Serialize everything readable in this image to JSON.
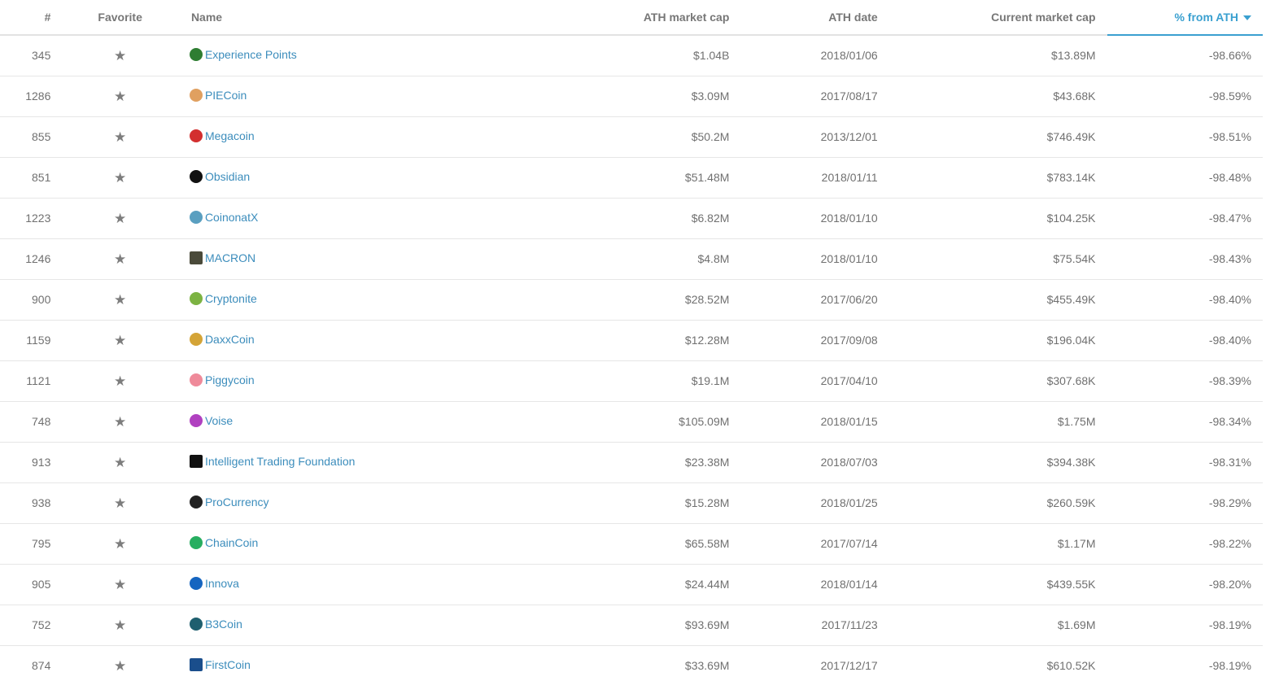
{
  "header": {
    "rank": "#",
    "favorite": "Favorite",
    "name": "Name",
    "ath_market_cap": "ATH market cap",
    "ath_date": "ATH date",
    "current_market_cap": "Current market cap",
    "pct_from_ath": "% from ATH"
  },
  "rows": [
    {
      "rank": "345",
      "name": "Experience Points",
      "icon": "experience-points-icon",
      "color": "#2e7d32",
      "ath_cap": "$1.04B",
      "ath_date": "2018/01/06",
      "cur_cap": "$13.89M",
      "pct": "-98.66%"
    },
    {
      "rank": "1286",
      "name": "PIECoin",
      "icon": "piecoin-icon",
      "color": "#e0a060",
      "ath_cap": "$3.09M",
      "ath_date": "2017/08/17",
      "cur_cap": "$43.68K",
      "pct": "-98.59%"
    },
    {
      "rank": "855",
      "name": "Megacoin",
      "icon": "megacoin-icon",
      "color": "#d32f2f",
      "ath_cap": "$50.2M",
      "ath_date": "2013/12/01",
      "cur_cap": "$746.49K",
      "pct": "-98.51%"
    },
    {
      "rank": "851",
      "name": "Obsidian",
      "icon": "obsidian-icon",
      "color": "#111111",
      "ath_cap": "$51.48M",
      "ath_date": "2018/01/11",
      "cur_cap": "$783.14K",
      "pct": "-98.48%"
    },
    {
      "rank": "1223",
      "name": "CoinonatX",
      "icon": "coinonatx-icon",
      "color": "#5a9fc0",
      "ath_cap": "$6.82M",
      "ath_date": "2018/01/10",
      "cur_cap": "$104.25K",
      "pct": "-98.47%"
    },
    {
      "rank": "1246",
      "name": "MACRON",
      "icon": "macron-icon",
      "color": "#4a4a3a",
      "ath_cap": "$4.8M",
      "ath_date": "2018/01/10",
      "cur_cap": "$75.54K",
      "pct": "-98.43%"
    },
    {
      "rank": "900",
      "name": "Cryptonite",
      "icon": "cryptonite-icon",
      "color": "#7cb342",
      "ath_cap": "$28.52M",
      "ath_date": "2017/06/20",
      "cur_cap": "$455.49K",
      "pct": "-98.40%"
    },
    {
      "rank": "1159",
      "name": "DaxxCoin",
      "icon": "daxxcoin-icon",
      "color": "#d4a437",
      "ath_cap": "$12.28M",
      "ath_date": "2017/09/08",
      "cur_cap": "$196.04K",
      "pct": "-98.40%"
    },
    {
      "rank": "1121",
      "name": "Piggycoin",
      "icon": "piggycoin-icon",
      "color": "#ef8a9a",
      "ath_cap": "$19.1M",
      "ath_date": "2017/04/10",
      "cur_cap": "$307.68K",
      "pct": "-98.39%"
    },
    {
      "rank": "748",
      "name": "Voise",
      "icon": "voise-icon",
      "color": "#b040c0",
      "ath_cap": "$105.09M",
      "ath_date": "2018/01/15",
      "cur_cap": "$1.75M",
      "pct": "-98.34%"
    },
    {
      "rank": "913",
      "name": "Intelligent Trading Foundation",
      "icon": "itf-icon",
      "color": "#111111",
      "ath_cap": "$23.38M",
      "ath_date": "2018/07/03",
      "cur_cap": "$394.38K",
      "pct": "-98.31%"
    },
    {
      "rank": "938",
      "name": "ProCurrency",
      "icon": "procurrency-icon",
      "color": "#222222",
      "ath_cap": "$15.28M",
      "ath_date": "2018/01/25",
      "cur_cap": "$260.59K",
      "pct": "-98.29%"
    },
    {
      "rank": "795",
      "name": "ChainCoin",
      "icon": "chaincoin-icon",
      "color": "#27ae60",
      "ath_cap": "$65.58M",
      "ath_date": "2017/07/14",
      "cur_cap": "$1.17M",
      "pct": "-98.22%"
    },
    {
      "rank": "905",
      "name": "Innova",
      "icon": "innova-icon",
      "color": "#1565c0",
      "ath_cap": "$24.44M",
      "ath_date": "2018/01/14",
      "cur_cap": "$439.55K",
      "pct": "-98.20%"
    },
    {
      "rank": "752",
      "name": "B3Coin",
      "icon": "b3coin-icon",
      "color": "#1f5f6f",
      "ath_cap": "$93.69M",
      "ath_date": "2017/11/23",
      "cur_cap": "$1.69M",
      "pct": "-98.19%"
    },
    {
      "rank": "874",
      "name": "FirstCoin",
      "icon": "firstcoin-icon",
      "color": "#1a4e8c",
      "ath_cap": "$33.69M",
      "ath_date": "2017/12/17",
      "cur_cap": "$610.52K",
      "pct": "-98.19%"
    }
  ]
}
